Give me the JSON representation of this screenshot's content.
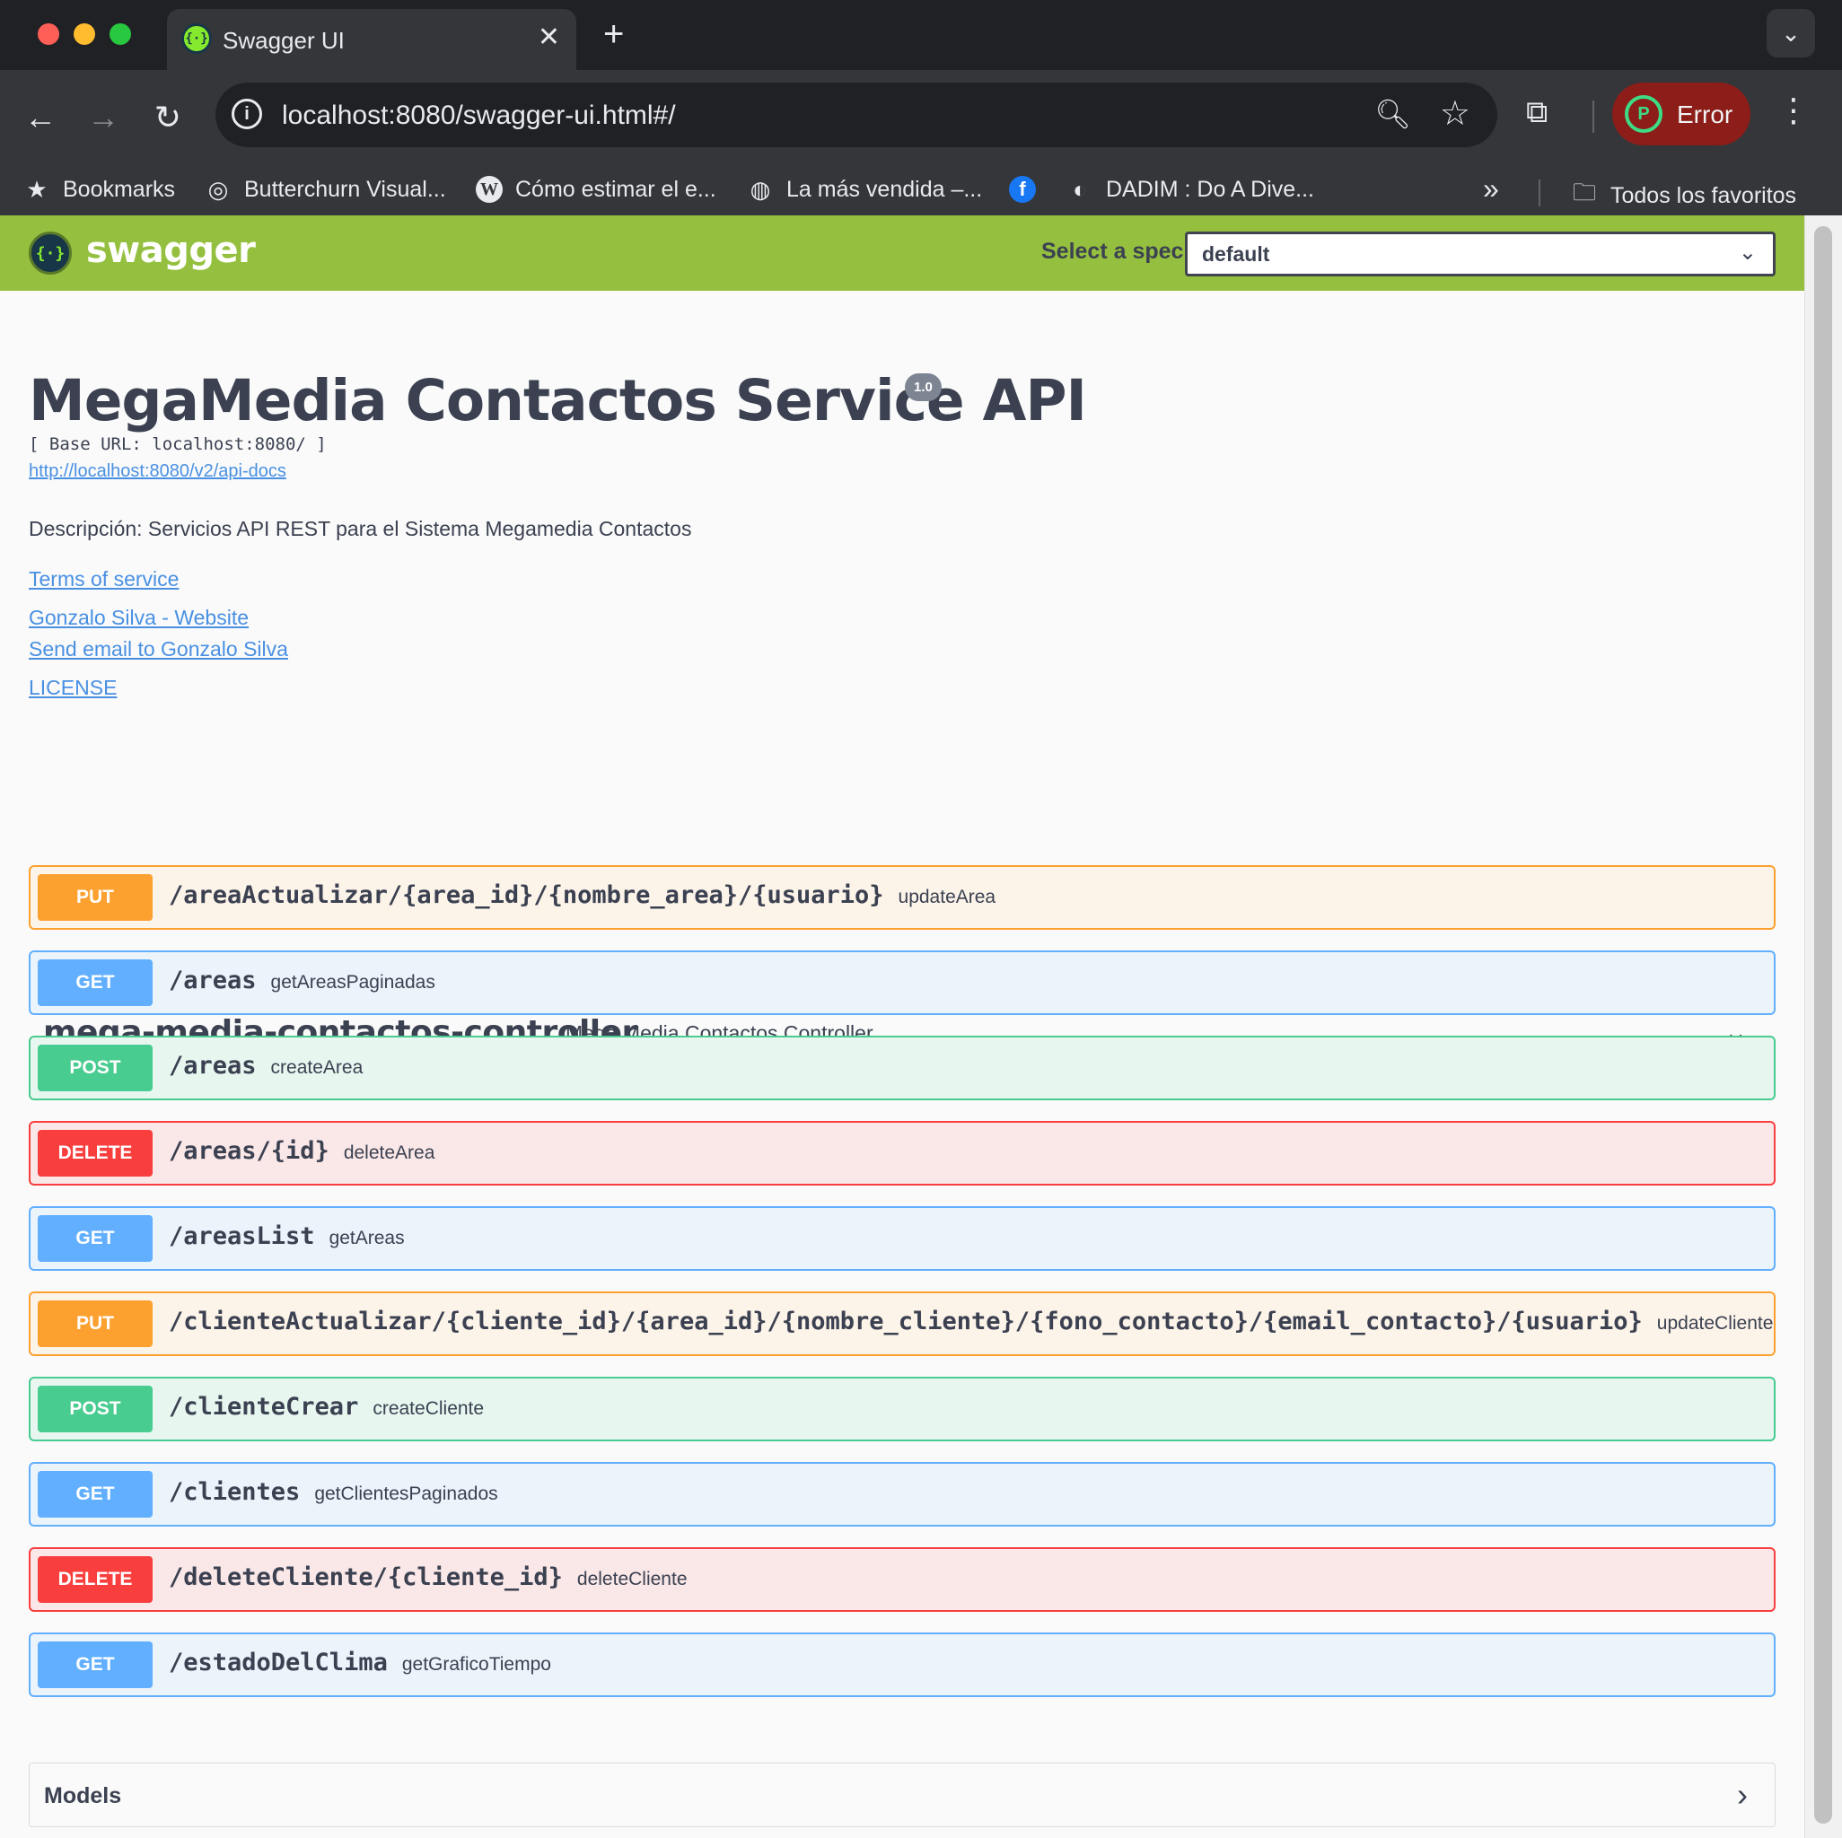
{
  "browser": {
    "tab_title": "Swagger UI",
    "url": "localhost:8080/swagger-ui.html#/",
    "profile_status": "Error",
    "bookmarks": [
      {
        "label": "Bookmarks",
        "icon": "star-icon"
      },
      {
        "label": "Butterchurn Visual...",
        "icon": "globe-icon"
      },
      {
        "label": "Cómo estimar el e...",
        "icon": "wordpress-icon"
      },
      {
        "label": "La más vendida –...",
        "icon": "globe-icon"
      },
      {
        "label": "",
        "icon": "facebook-icon"
      },
      {
        "label": "DADIM : Do A Dive...",
        "icon": "site-icon"
      }
    ],
    "all_bookmarks": "Todos los favoritos"
  },
  "swagger": {
    "brand": "swagger",
    "select_label": "Select a spec",
    "selected_spec": "default"
  },
  "info": {
    "title": "MegaMedia Contactos Service API",
    "version": "1.0",
    "base_url": "[ Base URL: localhost:8080/ ]",
    "spec_link": "http://localhost:8080/v2/api-docs",
    "description": "Descripción: Servicios API REST para el Sistema Megamedia Contactos",
    "links": {
      "terms": "Terms of service",
      "website": "Gonzalo Silva - Website",
      "email": "Send email to Gonzalo Silva",
      "license": "LICENSE"
    }
  },
  "tag": {
    "name": "mega-media-contactos-controller",
    "description": "Mega Media Contactos Controller"
  },
  "operations": [
    {
      "method": "PUT",
      "path": "/areaActualizar/{area_id}/{nombre_area}/{usuario}",
      "summary": "updateArea"
    },
    {
      "method": "GET",
      "path": "/areas",
      "summary": "getAreasPaginadas"
    },
    {
      "method": "POST",
      "path": "/areas",
      "summary": "createArea"
    },
    {
      "method": "DELETE",
      "path": "/areas/{id}",
      "summary": "deleteArea"
    },
    {
      "method": "GET",
      "path": "/areasList",
      "summary": "getAreas"
    },
    {
      "method": "PUT",
      "path": "/clienteActualizar/{cliente_id}/{area_id}/{nombre_cliente}/{fono_contacto}/{email_contacto}/{usuario}",
      "summary": "updateCliente"
    },
    {
      "method": "POST",
      "path": "/clienteCrear",
      "summary": "createCliente"
    },
    {
      "method": "GET",
      "path": "/clientes",
      "summary": "getClientesPaginados"
    },
    {
      "method": "DELETE",
      "path": "/deleteCliente/{cliente_id}",
      "summary": "deleteCliente"
    },
    {
      "method": "GET",
      "path": "/estadoDelClima",
      "summary": "getGraficoTiempo"
    }
  ],
  "models": {
    "title": "Models"
  },
  "colors": {
    "put": "#fca130",
    "get": "#61affe",
    "post": "#49cc90",
    "delete": "#f93e3e",
    "topbar": "#95c03f"
  }
}
